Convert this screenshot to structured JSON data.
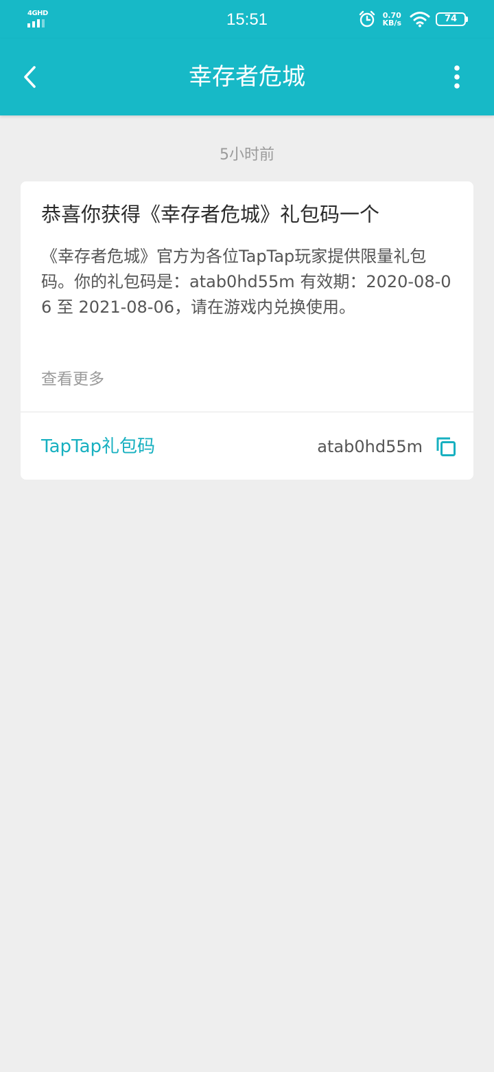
{
  "status_bar": {
    "network": "4GHD",
    "time": "15:51",
    "speed_value": "0.70",
    "speed_unit": "KB/s",
    "battery": "74",
    "icons": [
      "signal-icon",
      "alarm-icon",
      "wifi-icon",
      "battery-icon"
    ]
  },
  "app_bar": {
    "title": "幸存者危城",
    "back_icon": "chevron-left-icon",
    "more_icon": "more-vertical-icon"
  },
  "message": {
    "timestamp": "5小时前",
    "title": "恭喜你获得《幸存者危城》礼包码一个",
    "body": "《幸存者危城》官方为各位TapTap玩家提供限量礼包码。你的礼包码是：atab0hd55m 有效期：2020-08-06 至 2021-08-06，请在游戏内兑换使用。",
    "view_more": "查看更多",
    "code_label": "TapTap礼包码",
    "code_value": "atab0hd55m",
    "copy_icon": "copy-icon"
  },
  "colors": {
    "accent": "#17b9c7",
    "link": "#17b0c0",
    "background": "#eeeeee",
    "card": "#ffffff"
  }
}
